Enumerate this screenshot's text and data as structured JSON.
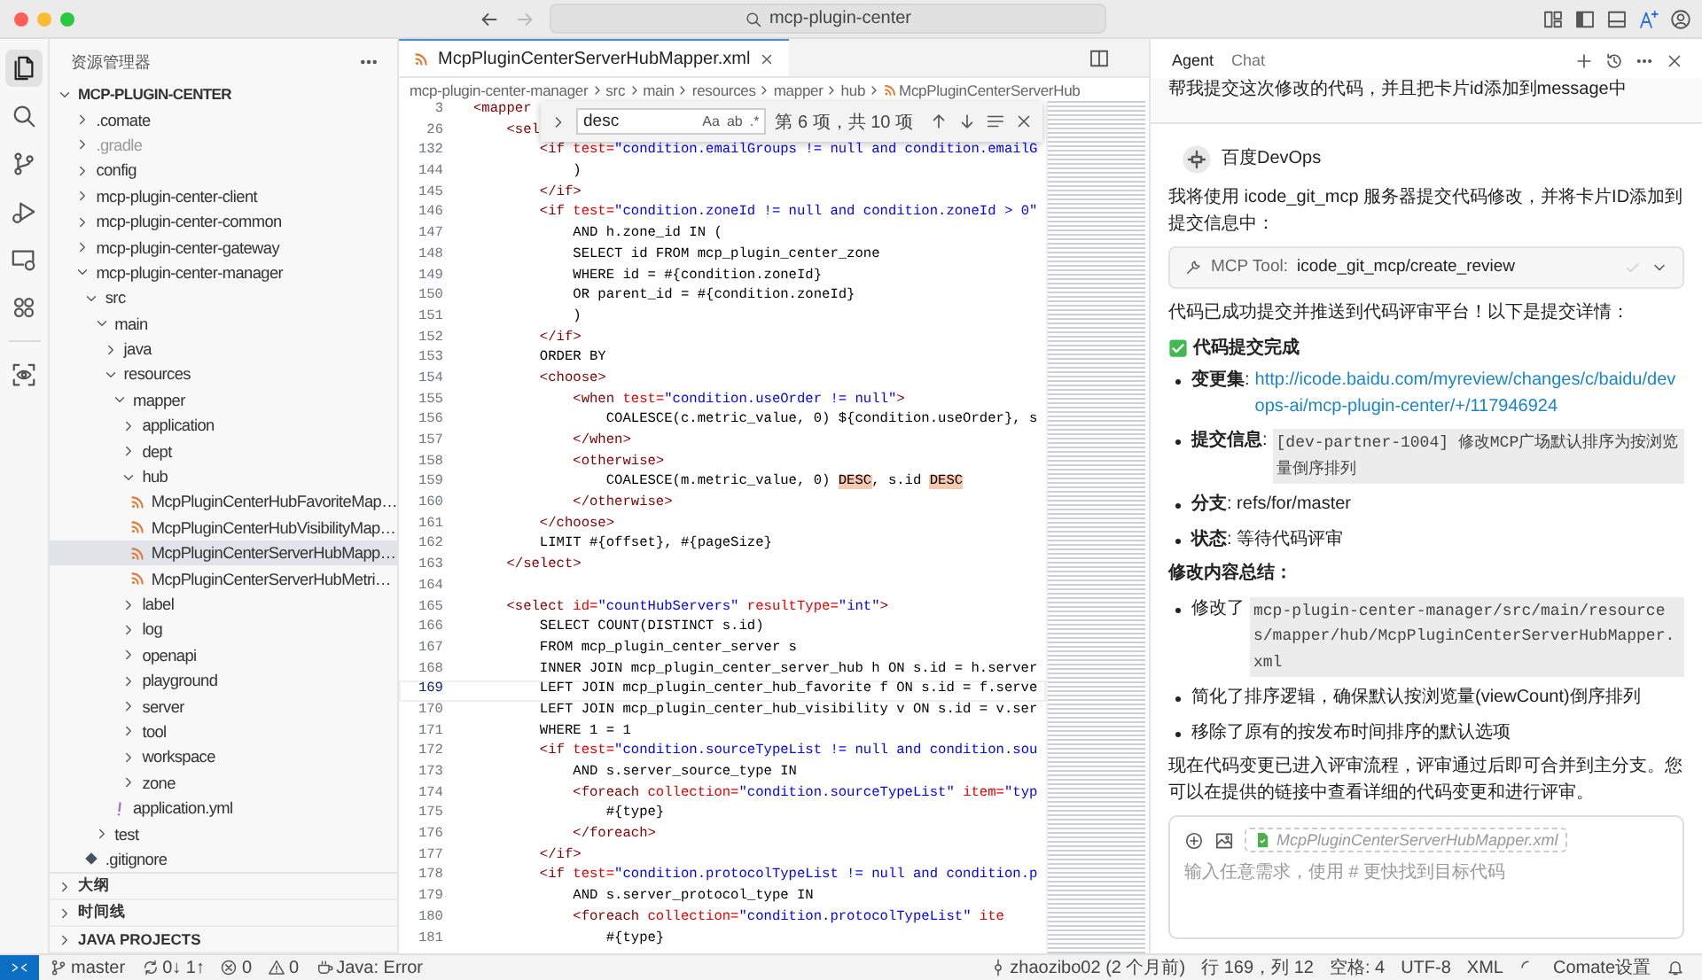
{
  "title_bar": {
    "search": "mcp-plugin-center"
  },
  "activity_bar": {
    "items": [
      {
        "selected": true
      },
      {
        "selected": false
      },
      {
        "selected": false
      },
      {
        "selected": false
      },
      {
        "selected": false
      },
      {
        "selected": false
      }
    ],
    "extra": [
      {
        "selected": false
      }
    ]
  },
  "sidebar": {
    "title": "资源管理器",
    "root": {
      "label": "MCP-PLUGIN-CENTER",
      "kind": "folder",
      "expanded": true,
      "selected": false,
      "children": [
        {
          "label": ".comate",
          "kind": "folder",
          "expanded": false,
          "selected": false
        },
        {
          "label": ".gradle",
          "kind": "ignored-folder",
          "expanded": false,
          "selected": false
        },
        {
          "label": "config",
          "kind": "folder",
          "expanded": false,
          "selected": false
        },
        {
          "label": "mcp-plugin-center-client",
          "kind": "folder",
          "expanded": false,
          "selected": false
        },
        {
          "label": "mcp-plugin-center-common",
          "kind": "folder",
          "expanded": false,
          "selected": false
        },
        {
          "label": "mcp-plugin-center-gateway",
          "kind": "folder",
          "expanded": false,
          "selected": false
        },
        {
          "label": "mcp-plugin-center-manager",
          "kind": "folder",
          "expanded": true,
          "selected": false,
          "children": [
            {
              "label": "src",
              "kind": "folder",
              "expanded": true,
              "selected": false,
              "children": [
                {
                  "label": "main",
                  "kind": "folder",
                  "expanded": true,
                  "selected": false,
                  "children": [
                    {
                      "label": "java",
                      "kind": "folder",
                      "expanded": false,
                      "selected": false
                    },
                    {
                      "label": "resources",
                      "kind": "folder",
                      "expanded": true,
                      "selected": false,
                      "children": [
                        {
                          "label": "mapper",
                          "kind": "folder",
                          "expanded": true,
                          "selected": false,
                          "children": [
                            {
                              "label": "application",
                              "kind": "folder",
                              "expanded": false,
                              "selected": false
                            },
                            {
                              "label": "dept",
                              "kind": "folder",
                              "expanded": false,
                              "selected": false
                            },
                            {
                              "label": "hub",
                              "kind": "folder",
                              "expanded": true,
                              "selected": false,
                              "children": [
                                {
                                  "label": "McpPluginCenterHubFavoriteMap…",
                                  "kind": "xml",
                                  "selected": false
                                },
                                {
                                  "label": "McpPluginCenterHubVisibilityMap…",
                                  "kind": "xml",
                                  "selected": false
                                },
                                {
                                  "label": "McpPluginCenterServerHubMapp…",
                                  "kind": "xml",
                                  "selected": true
                                },
                                {
                                  "label": "McpPluginCenterServerHubMetri…",
                                  "kind": "xml",
                                  "selected": false
                                }
                              ]
                            },
                            {
                              "label": "label",
                              "kind": "folder",
                              "expanded": false,
                              "selected": false
                            },
                            {
                              "label": "log",
                              "kind": "folder",
                              "expanded": false,
                              "selected": false
                            },
                            {
                              "label": "openapi",
                              "kind": "folder",
                              "expanded": false,
                              "selected": false
                            },
                            {
                              "label": "playground",
                              "kind": "folder",
                              "expanded": false,
                              "selected": false
                            },
                            {
                              "label": "server",
                              "kind": "folder",
                              "expanded": false,
                              "selected": false
                            },
                            {
                              "label": "tool",
                              "kind": "folder",
                              "expanded": false,
                              "selected": false
                            },
                            {
                              "label": "workspace",
                              "kind": "folder",
                              "expanded": false,
                              "selected": false
                            },
                            {
                              "label": "zone",
                              "kind": "folder",
                              "expanded": false,
                              "selected": false
                            }
                          ]
                        },
                        {
                          "label": "application.yml",
                          "kind": "yaml",
                          "selected": false
                        }
                      ]
                    }
                  ]
                },
                {
                  "label": "test",
                  "kind": "folder",
                  "expanded": false,
                  "selected": false
                }
              ]
            },
            {
              "label": ".gitignore",
              "kind": "git",
              "selected": false
            }
          ]
        }
      ]
    },
    "sections": [
      {
        "label": "大纲",
        "expanded": false
      },
      {
        "label": "时间线",
        "expanded": false
      },
      {
        "label": "JAVA PROJECTS",
        "expanded": false
      }
    ]
  },
  "editor": {
    "tab": {
      "label": "McpPluginCenterServerHubMapper.xml",
      "selected": true
    },
    "breadcrumb": [
      "mcp-plugin-center-manager",
      "src",
      "main",
      "resources",
      "mapper",
      "hub",
      "McpPluginCenterServerHub"
    ],
    "find": {
      "value": "desc",
      "options": [
        "Aa",
        "ab",
        ".*"
      ],
      "result": "第 6 项，共 10 项"
    },
    "lines": [
      {
        "number": "3",
        "current": false,
        "tokens": [
          {
            "kind": "tag",
            "text": "<mapper"
          }
        ]
      },
      {
        "number": "26",
        "current": false,
        "tokens": [
          {
            "kind": "tag",
            "text": "    <sel"
          }
        ]
      },
      {
        "number": "132",
        "current": false,
        "tokens": [
          {
            "kind": "tag",
            "text": "        <if"
          },
          {
            "kind": "attr",
            "text": " test="
          },
          {
            "kind": "str",
            "text": "\"condition.emailGroups != null and condition.emailG"
          }
        ]
      },
      {
        "number": "144",
        "current": false,
        "tokens": [
          {
            "kind": "text",
            "text": "            )"
          }
        ]
      },
      {
        "number": "145",
        "current": false,
        "tokens": [
          {
            "kind": "tag",
            "text": "        </if>"
          }
        ]
      },
      {
        "number": "146",
        "current": false,
        "tokens": [
          {
            "kind": "tag",
            "text": "        <if"
          },
          {
            "kind": "attr",
            "text": " test="
          },
          {
            "kind": "str",
            "text": "\"condition.zoneId != null and condition.zoneId > 0\""
          }
        ]
      },
      {
        "number": "147",
        "current": false,
        "tokens": [
          {
            "kind": "text",
            "text": "            AND h.zone_id IN ("
          }
        ]
      },
      {
        "number": "148",
        "current": false,
        "tokens": [
          {
            "kind": "text",
            "text": "            SELECT id FROM mcp_plugin_center_zone"
          }
        ]
      },
      {
        "number": "149",
        "current": false,
        "tokens": [
          {
            "kind": "text",
            "text": "            WHERE id = #{condition.zoneId}"
          }
        ]
      },
      {
        "number": "150",
        "current": false,
        "tokens": [
          {
            "kind": "text",
            "text": "            OR parent_id = #{condition.zoneId}"
          }
        ]
      },
      {
        "number": "151",
        "current": false,
        "tokens": [
          {
            "kind": "text",
            "text": "            )"
          }
        ]
      },
      {
        "number": "152",
        "current": false,
        "tokens": [
          {
            "kind": "tag",
            "text": "        </if>"
          }
        ]
      },
      {
        "number": "153",
        "current": false,
        "tokens": [
          {
            "kind": "text",
            "text": "        ORDER BY"
          }
        ]
      },
      {
        "number": "154",
        "current": false,
        "tokens": [
          {
            "kind": "tag",
            "text": "        <choose>"
          }
        ]
      },
      {
        "number": "155",
        "current": false,
        "tokens": [
          {
            "kind": "tag",
            "text": "            <when"
          },
          {
            "kind": "attr",
            "text": " test="
          },
          {
            "kind": "str",
            "text": "\"condition.useOrder != null\""
          },
          {
            "kind": "tag",
            "text": ">"
          }
        ]
      },
      {
        "number": "156",
        "current": false,
        "tokens": [
          {
            "kind": "text",
            "text": "                COALESCE(c.metric_value, 0) ${condition.useOrder}, s"
          }
        ]
      },
      {
        "number": "157",
        "current": false,
        "tokens": [
          {
            "kind": "tag",
            "text": "            </when>"
          }
        ]
      },
      {
        "number": "158",
        "current": false,
        "tokens": [
          {
            "kind": "tag",
            "text": "            <otherwise>"
          }
        ]
      },
      {
        "number": "159",
        "current": false,
        "tokens": [
          {
            "kind": "text",
            "text": "                COALESCE(m.metric_value, 0) "
          },
          {
            "kind": "match",
            "text": "DESC"
          },
          {
            "kind": "text",
            "text": ", s.id "
          },
          {
            "kind": "match",
            "text": "DESC"
          }
        ]
      },
      {
        "number": "160",
        "current": false,
        "tokens": [
          {
            "kind": "tag",
            "text": "            </otherwise>"
          }
        ]
      },
      {
        "number": "161",
        "current": false,
        "tokens": [
          {
            "kind": "tag",
            "text": "        </choose>"
          }
        ]
      },
      {
        "number": "162",
        "current": false,
        "tokens": [
          {
            "kind": "text",
            "text": "        LIMIT #{offset}, #{pageSize}"
          }
        ]
      },
      {
        "number": "163",
        "current": false,
        "tokens": [
          {
            "kind": "tag",
            "text": "    </select>"
          }
        ]
      },
      {
        "number": "164",
        "current": false
      },
      {
        "number": "165",
        "current": false,
        "tokens": [
          {
            "kind": "tag",
            "text": "    <select"
          },
          {
            "kind": "attr",
            "text": " id="
          },
          {
            "kind": "str",
            "text": "\"countHubServers\""
          },
          {
            "kind": "attr",
            "text": " resultType="
          },
          {
            "kind": "str",
            "text": "\"int\""
          },
          {
            "kind": "tag",
            "text": ">"
          }
        ]
      },
      {
        "number": "166",
        "current": false,
        "tokens": [
          {
            "kind": "text",
            "text": "        SELECT COUNT(DISTINCT s.id)"
          }
        ]
      },
      {
        "number": "167",
        "current": false,
        "tokens": [
          {
            "kind": "text",
            "text": "        FROM mcp_plugin_center_server s"
          }
        ]
      },
      {
        "number": "168",
        "current": false,
        "tokens": [
          {
            "kind": "text",
            "text": "        INNER JOIN mcp_plugin_center_server_hub h ON s.id = h.server"
          }
        ]
      },
      {
        "number": "169",
        "current": true,
        "tokens": [
          {
            "kind": "text",
            "text": "        LEFT JOIN mcp_plugin_center_hub_favorite f ON s.id = f.serve"
          }
        ]
      },
      {
        "number": "170",
        "current": false,
        "tokens": [
          {
            "kind": "text",
            "text": "        LEFT JOIN mcp_plugin_center_hub_visibility v ON s.id = v.ser"
          }
        ]
      },
      {
        "number": "171",
        "current": false,
        "tokens": [
          {
            "kind": "text",
            "text": "        WHERE 1 = 1"
          }
        ]
      },
      {
        "number": "172",
        "current": false,
        "tokens": [
          {
            "kind": "tag",
            "text": "        <if"
          },
          {
            "kind": "attr",
            "text": " test="
          },
          {
            "kind": "str",
            "text": "\"condition.sourceTypeList != null and condition.sou"
          }
        ]
      },
      {
        "number": "173",
        "current": false,
        "tokens": [
          {
            "kind": "text",
            "text": "            AND s.server_source_type IN"
          }
        ]
      },
      {
        "number": "174",
        "current": false,
        "tokens": [
          {
            "kind": "tag",
            "text": "            <foreach"
          },
          {
            "kind": "attr",
            "text": " collection="
          },
          {
            "kind": "str",
            "text": "\"condition.sourceTypeList\""
          },
          {
            "kind": "attr",
            "text": " item="
          },
          {
            "kind": "str",
            "text": "\"typ"
          }
        ]
      },
      {
        "number": "175",
        "current": false,
        "tokens": [
          {
            "kind": "text",
            "text": "                #{type}"
          }
        ]
      },
      {
        "number": "176",
        "current": false,
        "tokens": [
          {
            "kind": "tag",
            "text": "            </foreach>"
          }
        ]
      },
      {
        "number": "177",
        "current": false,
        "tokens": [
          {
            "kind": "tag",
            "text": "        </if>"
          }
        ]
      },
      {
        "number": "178",
        "current": false,
        "tokens": [
          {
            "kind": "tag",
            "text": "        <if"
          },
          {
            "kind": "attr",
            "text": " test="
          },
          {
            "kind": "str",
            "text": "\"condition.protocolTypeList != null and condition.p"
          }
        ]
      },
      {
        "number": "179",
        "current": false,
        "tokens": [
          {
            "kind": "text",
            "text": "            AND s.server_protocol_type IN"
          }
        ]
      },
      {
        "number": "180",
        "current": false,
        "tokens": [
          {
            "kind": "tag",
            "text": "            <foreach"
          },
          {
            "kind": "attr",
            "text": " collection="
          },
          {
            "kind": "str",
            "text": "\"condition.protocolTypeList\""
          },
          {
            "kind": "attr",
            "text": " ite"
          }
        ]
      },
      {
        "number": "181",
        "current": false,
        "tokens": [
          {
            "kind": "text",
            "text": "                #{type}"
          }
        ]
      }
    ]
  },
  "chat": {
    "tabs": [
      {
        "label": "Agent",
        "selected": true
      },
      {
        "label": "Chat",
        "selected": false
      }
    ],
    "user_message": "帮我提交这次修改的代码，并且把卡片id添加到message中",
    "assistant": {
      "name": "百度DevOps",
      "intro": "我将使用 icode_git_mcp 服务器提交代码修改，并将卡片ID添加到提交信息中：",
      "tool_call": {
        "label": "MCP Tool:",
        "name": "icode_git_mcp/create_review",
        "expanded": false
      },
      "summary": "代码已成功提交并推送到代码评审平台！以下是提交详情：",
      "done_heading": "代码提交完成",
      "details": [
        {
          "kind": "link",
          "label": "**变更集**:",
          "value": "http://icode.baidu.com/myreview/changes/c/baidu/devops-ai/mcp-plugin-center/+/117946924"
        },
        {
          "kind": "code",
          "label": "**提交信息**:",
          "value": "[dev-partner-1004] 修改MCP广场默认排序为按浏览量倒序排列"
        },
        {
          "kind": "text",
          "value": "**分支**: refs/for/master"
        },
        {
          "kind": "text",
          "value": "**状态**: 等待代码评审"
        }
      ],
      "changes_heading": "修改内容总结：",
      "changes": [
        {
          "kind": "code",
          "label": "修改了",
          "value": "mcp-plugin-center-manager/src/main/resources/mapper/hub/McpPluginCenterServerHubMapper.xml"
        },
        {
          "kind": "text",
          "value": "简化了排序逻辑，确保默认按浏览量(viewCount)倒序排列"
        },
        {
          "kind": "text",
          "value": "移除了原有的按发布时间排序的默认选项"
        }
      ],
      "closing": "现在代码变更已进入评审流程，评审通过后即可合并到主分支。您可以在提供的链接中查看详细的代码变更和进行评审。"
    },
    "composer": {
      "attachment": "McpPluginCenterServerHubMapper.xml",
      "placeholder": "输入任意需求，使用 # 更快找到目标代码"
    }
  },
  "status_bar": {
    "left": [
      {
        "kind": "branch",
        "text": "master"
      },
      {
        "kind": "sync",
        "text": "0↓ 1↑"
      },
      {
        "kind": "errors",
        "text": "0"
      },
      {
        "kind": "warnings",
        "text": "0"
      },
      {
        "kind": "java",
        "text": "Java: Error"
      }
    ],
    "right": [
      {
        "kind": "blame",
        "text": "zhaozibo02 (2 个月前)"
      },
      {
        "kind": "plain",
        "text": "行 169，列 12"
      },
      {
        "kind": "plain",
        "text": "空格: 4"
      },
      {
        "kind": "plain",
        "text": "UTF-8"
      },
      {
        "kind": "plain",
        "text": "XML"
      },
      {
        "kind": "spinner"
      },
      {
        "kind": "plain",
        "text": "Comate设置"
      },
      {
        "kind": "bell"
      }
    ]
  }
}
